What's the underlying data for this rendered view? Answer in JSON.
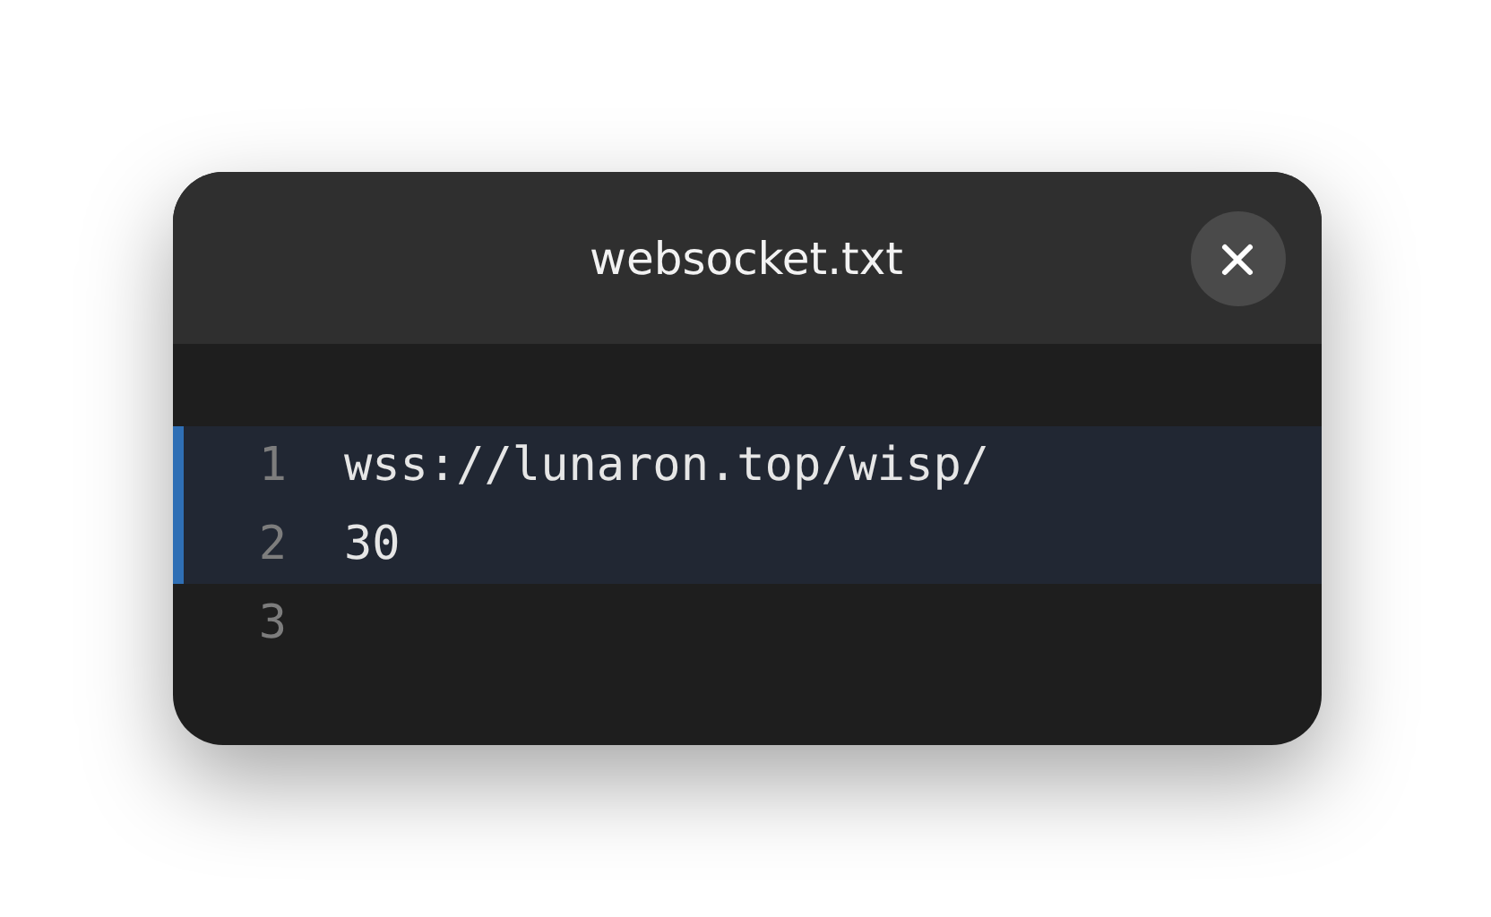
{
  "window": {
    "title": "websocket.txt"
  },
  "editor": {
    "lines": [
      {
        "number": "1",
        "text": "wss://lunaron.top/wisp/",
        "selected": true
      },
      {
        "number": "2",
        "text": "30",
        "selected": true
      },
      {
        "number": "3",
        "selected": false
      }
    ]
  }
}
